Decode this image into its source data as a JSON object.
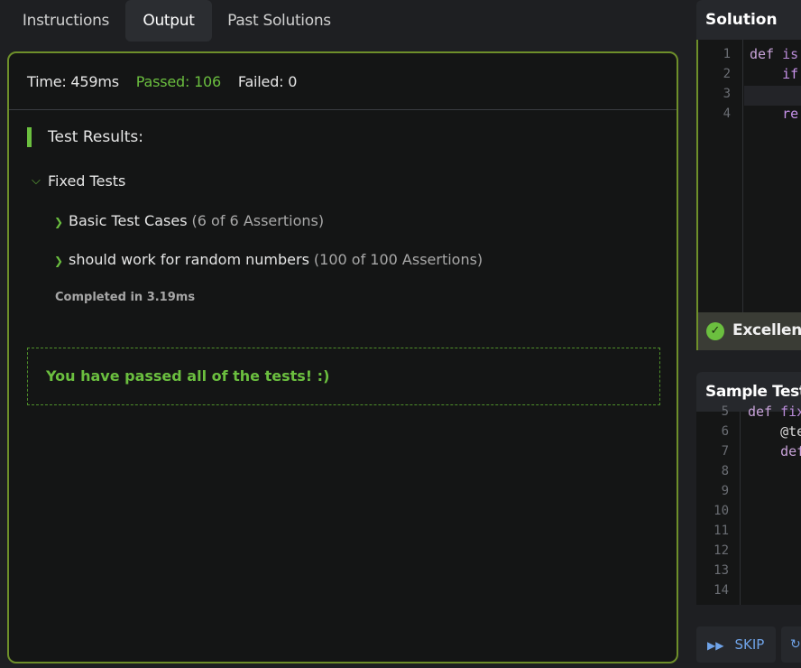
{
  "tabs": [
    {
      "label": "Instructions",
      "active": false
    },
    {
      "label": "Output",
      "active": true
    },
    {
      "label": "Past Solutions",
      "active": false
    }
  ],
  "output": {
    "time": "Time: 459ms",
    "passed": "Passed: 106",
    "failed": "Failed: 0",
    "results_heading": "Test Results:",
    "group": {
      "label": "Fixed Tests",
      "cases": [
        {
          "label": "Basic Test Cases",
          "assertions": "(6 of 6 Assertions)"
        },
        {
          "label": "should work for random numbers",
          "assertions": "(100 of 100 Assertions)"
        }
      ]
    },
    "completed": "Completed in 3.19ms",
    "pass_message": "You have passed all of the tests! :)"
  },
  "solution": {
    "title": "Solution",
    "line_numbers": [
      "1",
      "2",
      "3",
      "4"
    ],
    "lines": [
      {
        "kw": "def",
        "rest": " is"
      },
      {
        "kw": "    if",
        "rest": ""
      },
      {
        "kw": "",
        "rest": ""
      },
      {
        "kw": "    re",
        "rest": ""
      }
    ],
    "status": "Excellent"
  },
  "sample_tests": {
    "title": "Sample Tests",
    "line_numbers": [
      "5",
      "6",
      "7",
      "8",
      "9",
      "10",
      "11",
      "12",
      "13",
      "14"
    ],
    "lines": [
      {
        "kw": "def",
        "rest": " fix"
      },
      {
        "kw": "",
        "rest": "    @te"
      },
      {
        "kw": "    def",
        "rest": ""
      }
    ]
  },
  "buttons": {
    "skip": "SKIP"
  },
  "colors": {
    "accent_green": "#6bbf3f",
    "panel_border": "#6e8f2a",
    "link_blue": "#6fa3e8"
  }
}
